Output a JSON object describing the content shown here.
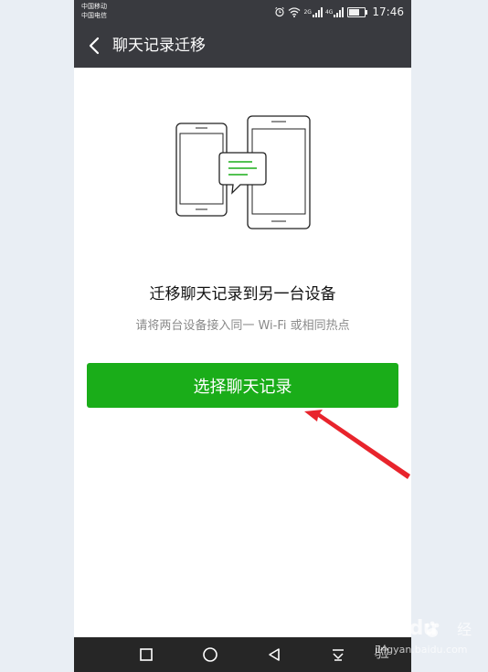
{
  "status_bar": {
    "carrier_1": "中国移动",
    "carrier_2": "中国电信",
    "net_1": "2G",
    "net_2": "4G",
    "time": "17:46"
  },
  "header": {
    "title": "聊天记录迁移"
  },
  "main": {
    "headline": "迁移聊天记录到另一台设备",
    "subtext": "请将两台设备接入同一 Wi-Fi 或相同热点",
    "primary_button": "选择聊天记录"
  },
  "watermark": {
    "brand": "Baidu",
    "jingyan": "经验",
    "url": "jingyan.baidu.com"
  },
  "colors": {
    "bar_dark": "#393a3f",
    "accent_green": "#1aad19",
    "annotation_red": "#e8242c"
  },
  "icons": {
    "back": "chevron-left-icon",
    "nav_recent": "square-icon",
    "nav_home": "circle-icon",
    "nav_back": "triangle-icon",
    "nav_notifications": "pull-down-icon"
  }
}
